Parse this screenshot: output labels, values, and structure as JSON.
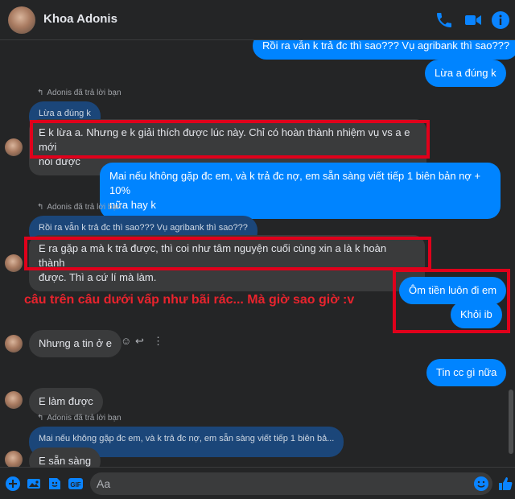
{
  "header": {
    "contact_name": "Khoa Adonis"
  },
  "messages": {
    "m1": "Rồi ra vẫn k trả đc thì sao??? Vụ agribank thì sao???",
    "m2": "Lừa a đúng k",
    "reply1_label": "Adonis đã trả lời bạn",
    "reply1_quote": "Lừa a đúng k",
    "m3_line1": "E k lừa a. Nhưng e k giải thích được lúc này. Chỉ có hoàn thành nhiệm vụ vs a e mới",
    "m3_line2": "nói được",
    "m4_line1": "Mai nếu không gặp đc em, và k trả đc nợ, em sẵn sàng viết tiếp 1 biên bản nợ + 10%",
    "m4_line2": "nữa hay k",
    "reply2_label": "Adonis đã trả lời bạn",
    "reply2_quote": "Rồi ra vẫn k trả đc thì sao??? Vụ agribank thì sao???",
    "m5_line1": "E ra gặp a mà k trả được, thì coi như tâm nguyện cuối cùng xin a là k hoàn thành",
    "m5_line2": "được. Thì a cứ lí mà làm.",
    "m6": "Ôm tiền luôn đi em",
    "m7": "Khỏi ib",
    "m8": "Nhưng a tin ở e",
    "m9": "Tin cc gì nữa",
    "m10": "E làm được",
    "reply3_label": "Adonis đã trả lời bạn",
    "reply3_quote": "Mai nếu không gặp đc em, và k trả đc nợ, em sẵn sàng viết tiếp 1 biên bả...",
    "m11": "E sẵn sàng"
  },
  "annotation": {
    "text": "câu trên câu dưới vấp như bãi rác... Mà giờ sao giờ :v",
    "color": "#e8232d"
  },
  "composer": {
    "placeholder": "Aa"
  },
  "icons": {
    "header": [
      "phone-icon",
      "video-icon",
      "info-icon"
    ],
    "footer": [
      "plus-icon",
      "image-icon",
      "sticker-icon",
      "gif-icon",
      "emoji-icon",
      "like-icon"
    ]
  },
  "colors": {
    "accent": "#0084ff",
    "background": "#242526",
    "incoming_bubble": "#3a3b3c",
    "highlight": "#e0001b"
  }
}
